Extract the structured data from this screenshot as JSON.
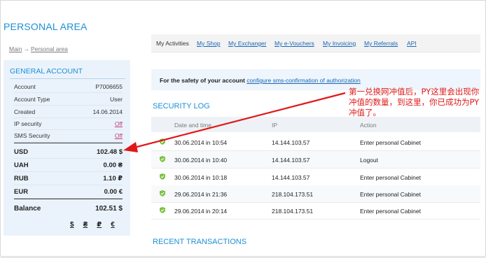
{
  "page": {
    "title": "PERSONAL AREA"
  },
  "breadcrumb": {
    "home": "Main",
    "separator": "→",
    "current": "Personal area"
  },
  "general_account": {
    "title": "GENERAL ACCOUNT",
    "rows": [
      {
        "label": "Account",
        "value": "P7006655"
      },
      {
        "label": "Account Type",
        "value": "User"
      },
      {
        "label": "Created",
        "value": "14.06.2014"
      },
      {
        "label": "IP security",
        "value": "Off"
      },
      {
        "label": "SMS Security",
        "value": "Off"
      }
    ],
    "balances": [
      {
        "currency": "USD",
        "amount": "102.48 $"
      },
      {
        "currency": "UAH",
        "amount": "0.00 ₴"
      },
      {
        "currency": "RUB",
        "amount": "1.10 ₽"
      },
      {
        "currency": "EUR",
        "amount": "0.00 €"
      }
    ],
    "total": {
      "label": "Balance",
      "amount": "102.51 $"
    },
    "currency_links": [
      "$",
      "₴",
      "₽",
      "€"
    ]
  },
  "top_nav": {
    "items": [
      "My Activities",
      "My Shop",
      "My Exchanger",
      "My e-Vouchers",
      "My Invoicing",
      "My Referrals",
      "API"
    ],
    "active": "My Activities"
  },
  "notice": {
    "text": "For the safety of your account",
    "link": "configure sms-confirmation of authorization"
  },
  "security_log": {
    "title": "SECURITY LOG",
    "columns": [
      "Date and time",
      "IP",
      "Action"
    ],
    "rows": [
      {
        "date": "30.06.2014 in 10:54",
        "ip": "14.144.103.57",
        "action": "Enter personal Cabinet"
      },
      {
        "date": "30.06.2014 in 10:40",
        "ip": "14.144.103.57",
        "action": "Logout"
      },
      {
        "date": "30.06.2014 in 10:18",
        "ip": "14.144.103.57",
        "action": "Enter personal Cabinet"
      },
      {
        "date": "29.06.2014 in 21:36",
        "ip": "218.104.173.51",
        "action": "Enter personal Cabinet"
      },
      {
        "date": "29.06.2014 in 20:14",
        "ip": "218.104.173.51",
        "action": "Enter personal Cabinet"
      }
    ]
  },
  "recent_transactions": {
    "title": "RECENT TRANSACTIONS"
  },
  "annotation": {
    "text": "第一兑换网冲值后，PY这里会出现你冲值的数量，到这里，你已成功为PY冲值了。",
    "color": "#e01818"
  },
  "colors": {
    "accent": "#1c8fd6",
    "link": "#1a66b5",
    "panel": "#eaf3fb",
    "off": "#c23a7b"
  }
}
